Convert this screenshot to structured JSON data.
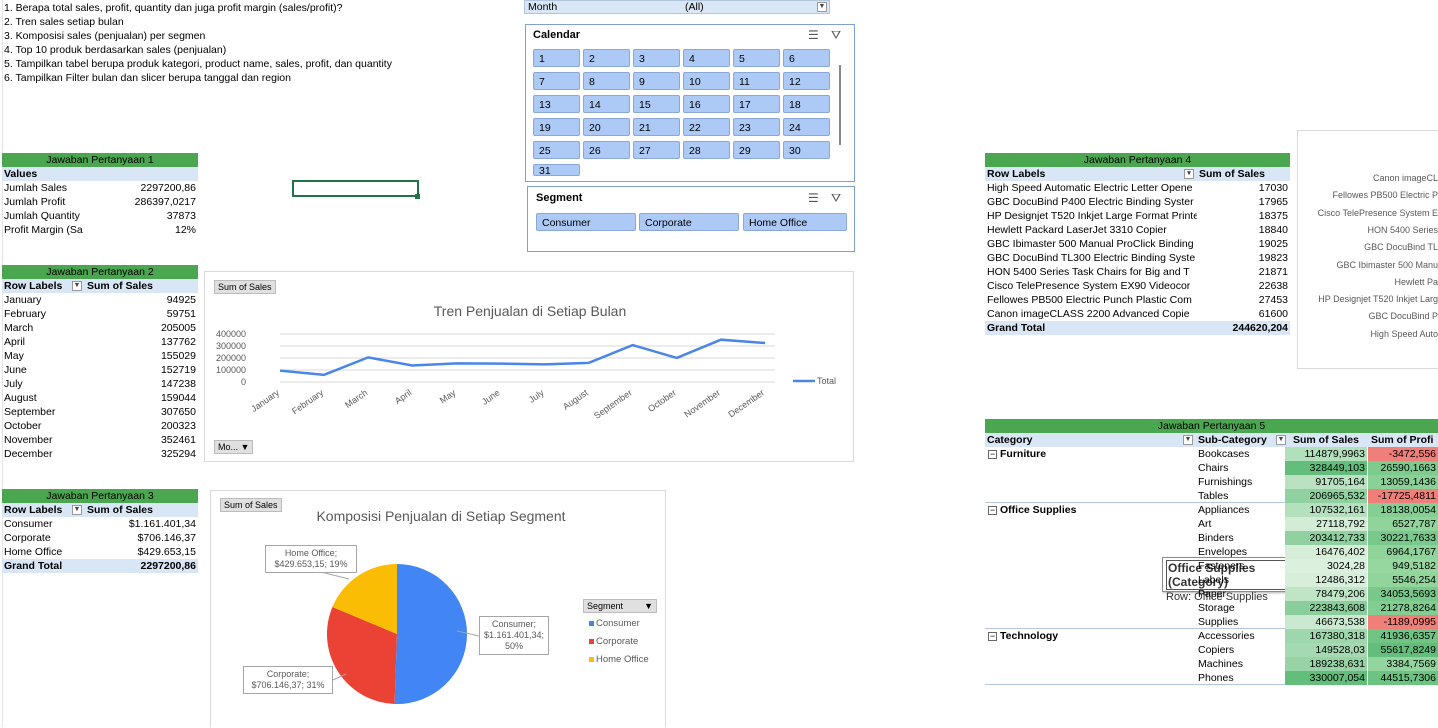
{
  "questions": [
    "1. Berapa total sales, profit, quantity dan juga profit margin (sales/profit)?",
    "2. Tren sales setiap bulan",
    "3. Komposisi sales (penjualan) per segmen",
    "4. Top 10 produk berdasarkan sales (penjualan)",
    "5. Tampilkan tabel berupa produk kategori, product name, sales, profit, dan quantity",
    "6. Tampilkan Filter bulan dan slicer berupa tanggal dan region"
  ],
  "month_filter": {
    "label": "Month",
    "value": "(All)"
  },
  "calendar_slicer": {
    "title": "Calendar",
    "days": [
      "1",
      "2",
      "3",
      "4",
      "5",
      "6",
      "7",
      "8",
      "9",
      "10",
      "11",
      "12",
      "13",
      "14",
      "15",
      "16",
      "17",
      "18",
      "19",
      "20",
      "21",
      "22",
      "23",
      "24",
      "25",
      "26",
      "27",
      "28",
      "29",
      "30",
      "31"
    ]
  },
  "segment_slicer": {
    "title": "Segment",
    "items": [
      "Consumer",
      "Corporate",
      "Home Office"
    ]
  },
  "q1": {
    "title": "Jawaban Pertanyaan 1",
    "header": "Values",
    "rows": [
      {
        "label": "Jumlah Sales",
        "value": "2297200,86"
      },
      {
        "label": "Jumlah Profit",
        "value": "286397,0217"
      },
      {
        "label": "Jumlah Quantity",
        "value": "37873"
      },
      {
        "label": "Profit Margin (Sa",
        "value": "12%"
      }
    ]
  },
  "q2": {
    "title": "Jawaban Pertanyaan 2",
    "col1": "Row Labels",
    "col2": "Sum of Sales",
    "rows": [
      {
        "label": "January",
        "value": "94925"
      },
      {
        "label": "February",
        "value": "59751"
      },
      {
        "label": "March",
        "value": "205005"
      },
      {
        "label": "April",
        "value": "137762"
      },
      {
        "label": "May",
        "value": "155029"
      },
      {
        "label": "June",
        "value": "152719"
      },
      {
        "label": "July",
        "value": "147238"
      },
      {
        "label": "August",
        "value": "159044"
      },
      {
        "label": "September",
        "value": "307650"
      },
      {
        "label": "October",
        "value": "200323"
      },
      {
        "label": "November",
        "value": "352461"
      },
      {
        "label": "December",
        "value": "325294"
      }
    ]
  },
  "q3": {
    "title": "Jawaban Pertanyaan 3",
    "col1": "Row Labels",
    "col2": "Sum of Sales",
    "rows": [
      {
        "label": "Consumer",
        "value": "$1.161.401,34"
      },
      {
        "label": "Corporate",
        "value": "$706.146,37"
      },
      {
        "label": "Home Office",
        "value": "$429.653,15"
      }
    ],
    "total_label": "Grand Total",
    "total_value": "2297200,86"
  },
  "chart_line": {
    "chip": "Sum of Sales",
    "title": "Tren Penjualan di Setiap Bulan",
    "legend": "Total",
    "filter_chip": "Mo...",
    "yticks": [
      "400000",
      "300000",
      "200000",
      "100000",
      "0"
    ]
  },
  "chart_pie": {
    "chip": "Sum of Sales",
    "title": "Komposisi Penjualan di Setiap Segment",
    "legend_title": "Segment",
    "callouts": {
      "home": [
        "Home Office;",
        "$429.653,15; 19%"
      ],
      "consumer": [
        "Consumer;",
        "$1.161.401,34;",
        "50%"
      ],
      "corporate": [
        "Corporate;",
        "$706.146,37; 31%"
      ]
    }
  },
  "chart_data": [
    {
      "type": "line",
      "title": "Tren Penjualan di Setiap Bulan",
      "xlabel": "",
      "ylabel": "",
      "categories": [
        "January",
        "February",
        "March",
        "April",
        "May",
        "June",
        "July",
        "August",
        "September",
        "October",
        "November",
        "December"
      ],
      "series": [
        {
          "name": "Total",
          "values": [
            94925,
            59751,
            205005,
            137762,
            155029,
            152719,
            147238,
            159044,
            307650,
            200323,
            352461,
            325294
          ],
          "color": "#4a86e8"
        }
      ],
      "ylim": [
        0,
        400000
      ],
      "grid": true,
      "legend": "right"
    },
    {
      "type": "pie",
      "title": "Komposisi Penjualan di Setiap Segment",
      "categories": [
        "Consumer",
        "Corporate",
        "Home Office"
      ],
      "values": [
        1161401.34,
        706146.37,
        429653.15
      ],
      "colors": [
        "#4285f4",
        "#ea4335",
        "#fbbc04"
      ],
      "legend": "right"
    }
  ],
  "q4": {
    "title": "Jawaban Pertanyaan 4",
    "col1": "Row Labels",
    "col2": "Sum of Sales",
    "rows": [
      {
        "label": "High Speed Automatic Electric Letter Opene",
        "value": "17030"
      },
      {
        "label": "GBC DocuBind P400 Electric Binding Syster",
        "value": "17965"
      },
      {
        "label": "HP Designjet T520 Inkjet Large Format Printe",
        "value": "18375"
      },
      {
        "label": "Hewlett Packard LaserJet 3310 Copier",
        "value": "18840"
      },
      {
        "label": "GBC Ibimaster 500 Manual ProClick Binding",
        "value": "19025"
      },
      {
        "label": "GBC DocuBind TL300 Electric Binding Syste",
        "value": "19823"
      },
      {
        "label": "HON 5400 Series Task Chairs for Big and T",
        "value": "21871"
      },
      {
        "label": "Cisco TelePresence System EX90 Videocor",
        "value": "22638"
      },
      {
        "label": "Fellowes PB500 Electric Punch Plastic Com",
        "value": "27453"
      },
      {
        "label": "Canon imageCLASS 2200 Advanced Copie",
        "value": "61600"
      }
    ],
    "total_label": "Grand Total",
    "total_value": "244620,204"
  },
  "q4_chart_labels": [
    "Canon imageCL",
    "Fellowes PB500 Electric P",
    "Cisco TelePresence System E",
    "HON 5400 Series",
    "GBC DocuBind TL",
    "GBC Ibimaster 500 Manu",
    "Hewlett Pa",
    "HP Designjet T520 Inkjet Larg",
    "GBC DocuBind P",
    "High Speed Auto"
  ],
  "q5": {
    "title": "Jawaban Pertanyaan 5",
    "headers": [
      "Category",
      "Sub-Category",
      "Sum of Sales",
      "Sum of Profi"
    ],
    "groups": [
      {
        "category": "Furniture",
        "rows": [
          {
            "sub": "Bookcases",
            "sales": "114879,9963",
            "profit": "-3472,556"
          },
          {
            "sub": "Chairs",
            "sales": "328449,103",
            "profit": "26590,1663"
          },
          {
            "sub": "Furnishings",
            "sales": "91705,164",
            "profit": "13059,1436"
          },
          {
            "sub": "Tables",
            "sales": "206965,532",
            "profit": "-17725,4811"
          }
        ]
      },
      {
        "category": "Office Supplies",
        "rows": [
          {
            "sub": "Appliances",
            "sales": "107532,161",
            "profit": "18138,0054"
          },
          {
            "sub": "Art",
            "sales": "27118,792",
            "profit": "6527,787"
          },
          {
            "sub": "Binders",
            "sales": "203412,733",
            "profit": "30221,7633"
          },
          {
            "sub": "Envelopes",
            "sales": "16476,402",
            "profit": "6964,1767"
          },
          {
            "sub": "Fasteners",
            "sales": "3024,28",
            "profit": "949,5182"
          },
          {
            "sub": "Labels",
            "sales": "12486,312",
            "profit": "5546,254"
          },
          {
            "sub": "Paper",
            "sales": "78479,206",
            "profit": "34053,5693"
          },
          {
            "sub": "Storage",
            "sales": "223843,608",
            "profit": "21278,8264"
          },
          {
            "sub": "Supplies",
            "sales": "46673,538",
            "profit": "-1189,0995"
          }
        ]
      },
      {
        "category": "Technology",
        "rows": [
          {
            "sub": "Accessories",
            "sales": "167380,318",
            "profit": "41936,6357"
          },
          {
            "sub": "Copiers",
            "sales": "149528,03",
            "profit": "55617,8249"
          },
          {
            "sub": "Machines",
            "sales": "189238,631",
            "profit": "3384,7569"
          },
          {
            "sub": "Phones",
            "sales": "330007,054",
            "profit": "44515,7306"
          }
        ]
      }
    ],
    "tooltip_title": "Office Supplies (Category)",
    "tooltip_body": "Row: Office Supplies"
  }
}
